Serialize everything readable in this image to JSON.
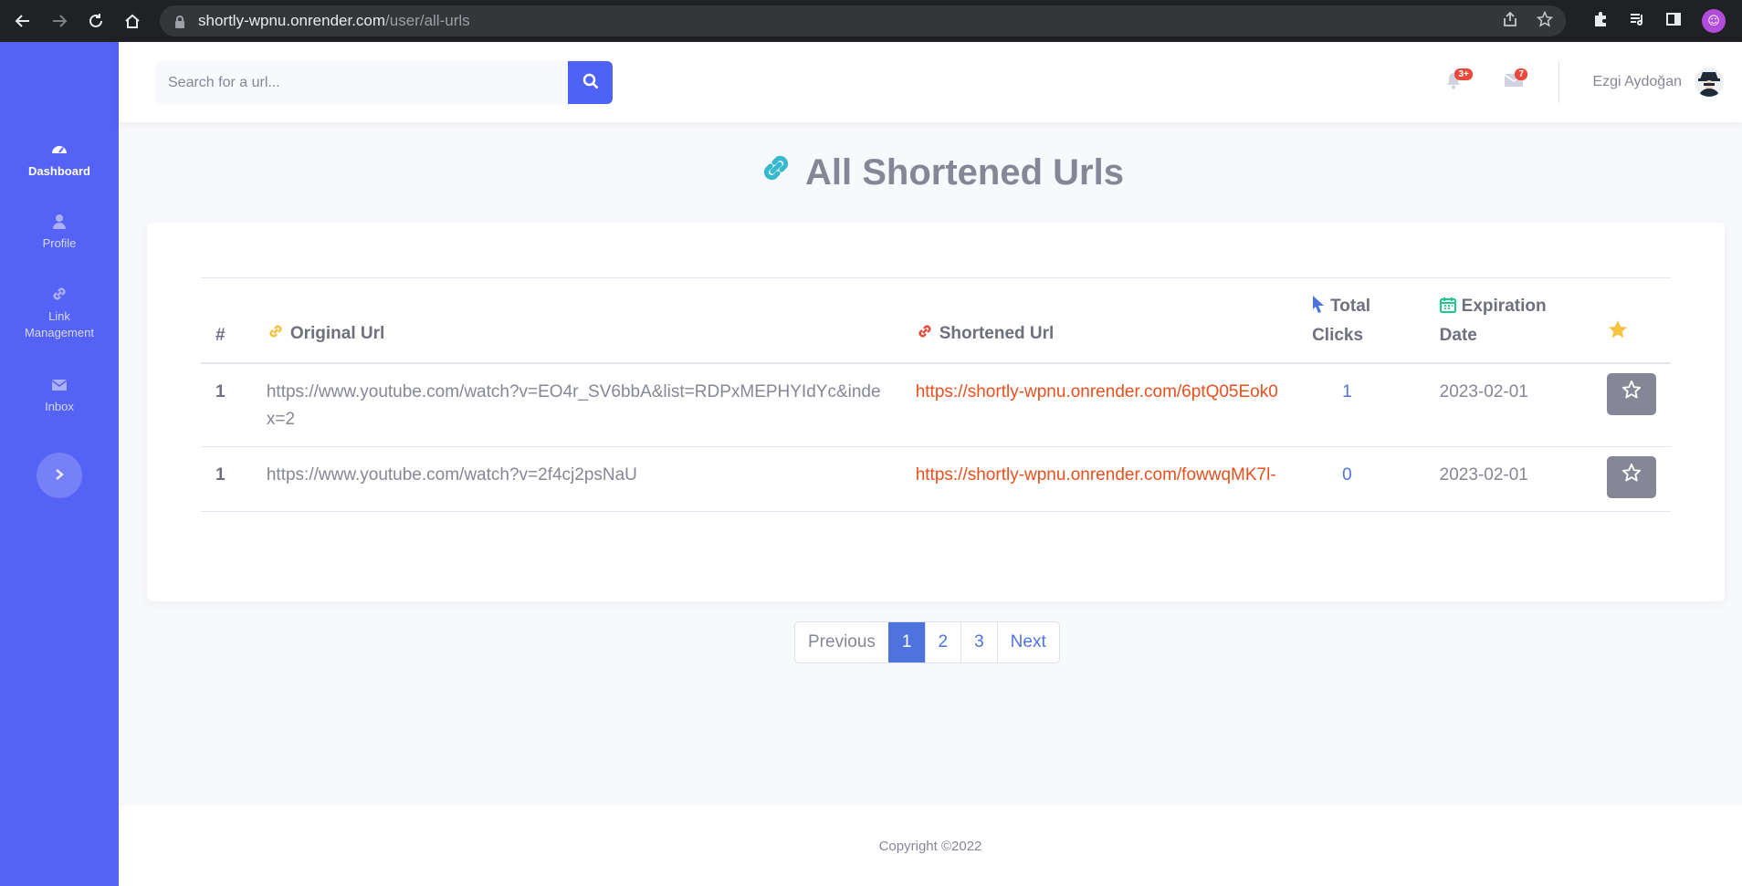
{
  "browser": {
    "url_host": "shortly-wpnu.onrender.com",
    "url_path": "/user/all-urls"
  },
  "sidebar": {
    "items": [
      {
        "label": "Dashboard",
        "icon": "dashboard-gauge-icon",
        "active": true
      },
      {
        "label": "Profile",
        "icon": "user-icon",
        "active": false
      },
      {
        "label": "Link\nManagement",
        "icon": "link-icon",
        "active": false
      },
      {
        "label": "Inbox",
        "icon": "envelope-icon",
        "active": false
      }
    ],
    "toggle_icon": "chevron-right-icon"
  },
  "topbar": {
    "search_placeholder": "Search for a url...",
    "alerts_badge": "3+",
    "messages_badge": "7",
    "user_name": "Ezgi Aydoğan"
  },
  "page": {
    "title": "All Shortened Urls"
  },
  "table": {
    "headers": {
      "num": "#",
      "original": "Original Url",
      "shortened": "Shortened Url",
      "clicks": "Total Clicks",
      "expiration": "Expiration Date"
    },
    "rows": [
      {
        "num": "1",
        "original": "https://www.youtube.com/watch?v=EO4r_SV6bbA&list=RDPxMEPHYIdYc&index=2",
        "shortened": "https://shortly-wpnu.onrender.com/6ptQ05Eok0",
        "clicks": "1",
        "expiration": "2023-02-01"
      },
      {
        "num": "1",
        "original": "https://www.youtube.com/watch?v=2f4cj2psNaU",
        "shortened": "https://shortly-wpnu.onrender.com/fowwqMK7l-",
        "clicks": "0",
        "expiration": "2023-02-01"
      }
    ]
  },
  "pagination": {
    "previous": "Previous",
    "pages": [
      "1",
      "2",
      "3"
    ],
    "next": "Next",
    "current": "1"
  },
  "footer": {
    "copyright": "Copyright ©2022"
  },
  "colors": {
    "sidebar": "#5462f5",
    "primary": "#4e73df",
    "short_link": "#e8501d",
    "star_button": "#858796"
  }
}
